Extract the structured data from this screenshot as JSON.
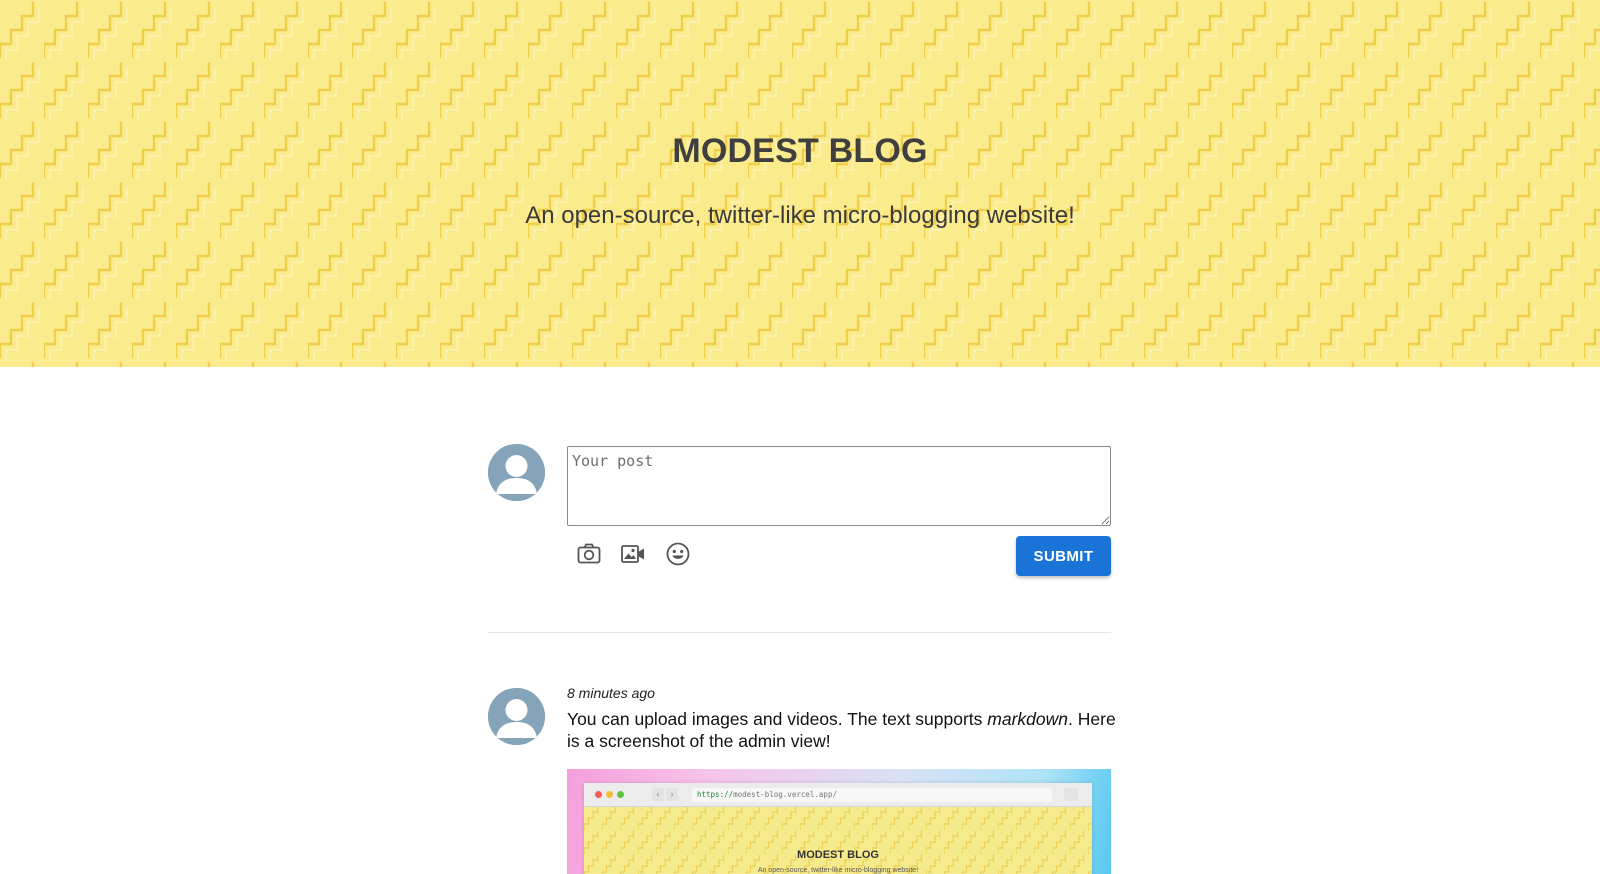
{
  "hero": {
    "title": "MODEST BLOG",
    "subtitle": "An open-source, twitter-like micro-blogging website!",
    "background_color": "#faeb8c",
    "pattern_color": "#efc93f"
  },
  "composer": {
    "placeholder": "Your post",
    "tools": [
      {
        "icon": "camera-icon"
      },
      {
        "icon": "video-camera-icon"
      },
      {
        "icon": "emoji-icon"
      }
    ],
    "submit_label": "SUBMIT",
    "submit_color": "#1a74d8"
  },
  "posts": [
    {
      "time": "8 minutes ago",
      "text_before": "You can upload images and videos. The text supports ",
      "text_emphasis": "markdown",
      "text_after": ". Here is a screenshot of the admin view!",
      "image": {
        "url_protocol": "https://",
        "url_rest": "modest-blog.vercel.app/",
        "title": "MODEST BLOG",
        "subtitle": "An open-source, twitter-like micro-blogging website!"
      }
    }
  ],
  "avatar_color": "#85a3b9"
}
